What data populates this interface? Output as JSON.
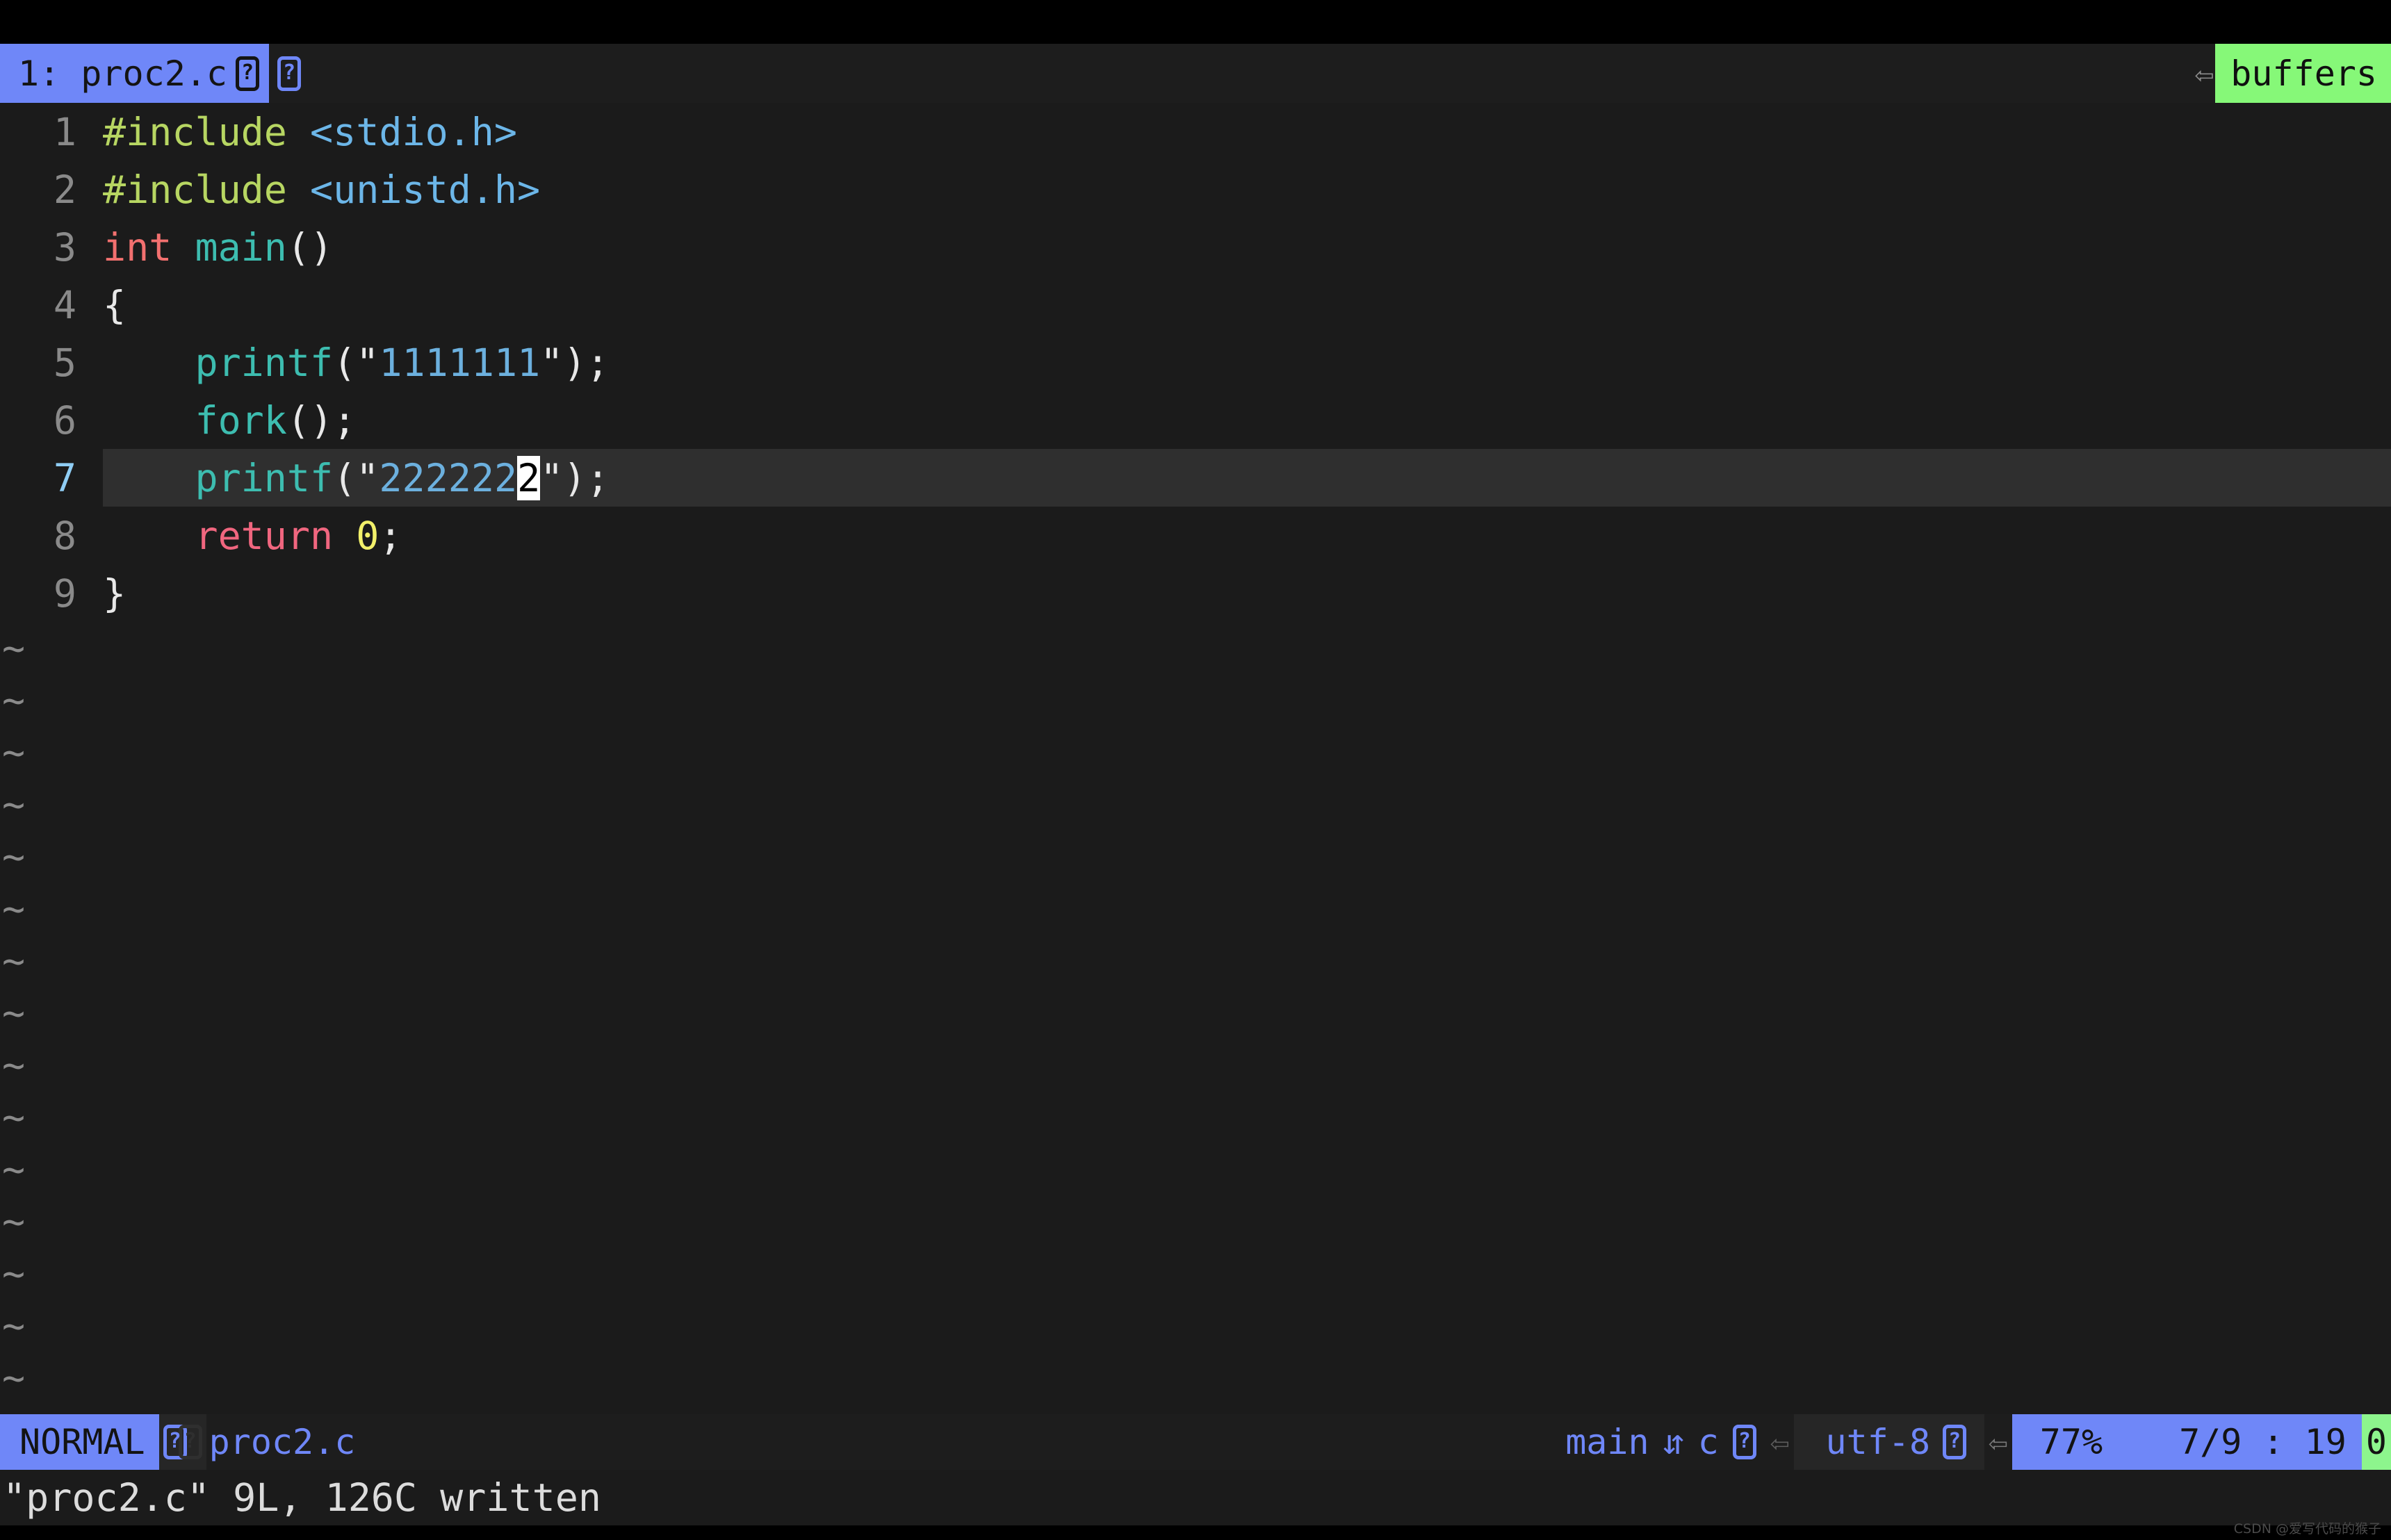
{
  "tabline": {
    "active_tab": "1: proc2.c",
    "tab_glyph_1": "?",
    "tab_glyph_2": "?",
    "separator_icon": "⇦",
    "buffers_label": "buffers"
  },
  "editor": {
    "lines": [
      {
        "num": "1",
        "tokens": [
          {
            "t": "#include ",
            "c": "t-pre"
          },
          {
            "t": "<stdio.h>",
            "c": "t-hdr"
          }
        ]
      },
      {
        "num": "2",
        "tokens": [
          {
            "t": "#include ",
            "c": "t-pre"
          },
          {
            "t": "<unistd.h>",
            "c": "t-hdr"
          }
        ]
      },
      {
        "num": "3",
        "tokens": [
          {
            "t": "int ",
            "c": "t-type"
          },
          {
            "t": "main",
            "c": "t-func"
          },
          {
            "t": "()",
            "c": "t-punct"
          }
        ]
      },
      {
        "num": "4",
        "tokens": [
          {
            "t": "{",
            "c": "t-punct"
          }
        ]
      },
      {
        "num": "5",
        "tokens": [
          {
            "t": "    ",
            "c": "t-punct"
          },
          {
            "t": "printf",
            "c": "t-func"
          },
          {
            "t": "(",
            "c": "t-punct"
          },
          {
            "t": "\"",
            "c": "t-quote"
          },
          {
            "t": "1111111",
            "c": "t-str"
          },
          {
            "t": "\"",
            "c": "t-quote"
          },
          {
            "t": ");",
            "c": "t-punct"
          }
        ]
      },
      {
        "num": "6",
        "tokens": [
          {
            "t": "    ",
            "c": "t-punct"
          },
          {
            "t": "fork",
            "c": "t-func"
          },
          {
            "t": "();",
            "c": "t-punct"
          }
        ]
      },
      {
        "num": "7",
        "cursorline": true,
        "tokens": [
          {
            "t": "    ",
            "c": "t-punct"
          },
          {
            "t": "printf",
            "c": "t-func"
          },
          {
            "t": "(",
            "c": "t-punct"
          },
          {
            "t": "\"",
            "c": "t-quote"
          },
          {
            "t": "222222",
            "c": "t-str"
          },
          {
            "t": "2",
            "c": "cursor-blk"
          },
          {
            "t": "\"",
            "c": "t-quote"
          },
          {
            "t": ");",
            "c": "t-punct"
          }
        ]
      },
      {
        "num": "8",
        "tokens": [
          {
            "t": "    ",
            "c": "t-punct"
          },
          {
            "t": "return ",
            "c": "t-kw"
          },
          {
            "t": "0",
            "c": "t-num"
          },
          {
            "t": ";",
            "c": "t-punct"
          }
        ]
      },
      {
        "num": "9",
        "tokens": [
          {
            "t": "}",
            "c": "t-punct"
          }
        ]
      }
    ],
    "filler_char": "~",
    "filler_count": 16
  },
  "statusline": {
    "mode": "NORMAL",
    "file_glyph_1": "?",
    "file_glyph_2": "?",
    "filename": "proc2.c",
    "git_branch": "main",
    "git_icon": "⇵",
    "filetype": "c",
    "filetype_glyph": "?",
    "separator_icon": "⇦",
    "encoding": "utf-8",
    "encoding_glyph": "?",
    "scroll_percent": "77%",
    "position": "7/9 : 19",
    "column": "0"
  },
  "message": {
    "text": "\"proc2.c\" 9L, 126C written"
  },
  "watermark": {
    "text": "CSDN @爱写代码的猴子"
  },
  "colors": {
    "accent_blue": "#6f87f8",
    "accent_green": "#86f878",
    "editor_bg": "#1b1b1b",
    "cursorline_bg": "#2f2f2f",
    "cursor_bg": "#ffffff"
  }
}
